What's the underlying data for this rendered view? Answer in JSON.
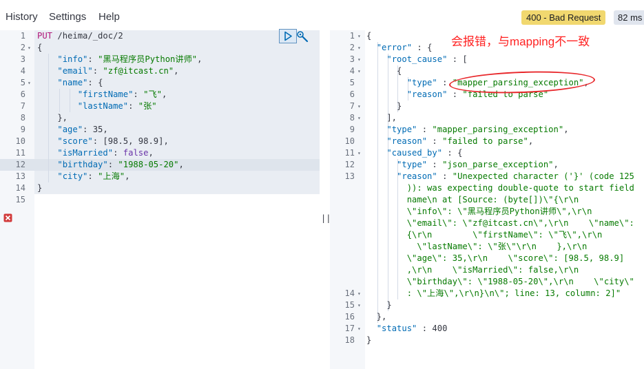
{
  "menu": {
    "history": "History",
    "settings": "Settings",
    "help": "Help"
  },
  "response_status": {
    "label": "400 - Bad Request",
    "time": "82 ms"
  },
  "annotation": "会报错，与mapping不一致",
  "divider_glyph": "||",
  "icons": {
    "run": "play-icon",
    "wrench": "wrench-icon",
    "error": "error-icon"
  },
  "request": {
    "line_numbers": [
      "1",
      "2",
      "3",
      "4",
      "5",
      "6",
      "7",
      "8",
      "9",
      "10",
      "11",
      "12",
      "13",
      "14",
      "15"
    ],
    "lines": [
      [
        {
          "t": "PUT",
          "c": "kw"
        },
        {
          "t": " /heima/_doc/2",
          "c": "n"
        }
      ],
      [
        {
          "t": "{",
          "c": "n"
        }
      ],
      [
        {
          "t": "    ",
          "c": "n"
        },
        {
          "t": "\"info\"",
          "c": "k"
        },
        {
          "t": ": ",
          "c": "n"
        },
        {
          "t": "\"黑马程序员Python讲师\"",
          "c": "s"
        },
        {
          "t": ",",
          "c": "n"
        }
      ],
      [
        {
          "t": "    ",
          "c": "n"
        },
        {
          "t": "\"email\"",
          "c": "k"
        },
        {
          "t": ": ",
          "c": "n"
        },
        {
          "t": "\"zf@itcast.cn\"",
          "c": "s"
        },
        {
          "t": ",",
          "c": "n"
        }
      ],
      [
        {
          "t": "    ",
          "c": "n"
        },
        {
          "t": "\"name\"",
          "c": "k"
        },
        {
          "t": ": {",
          "c": "n"
        }
      ],
      [
        {
          "t": "        ",
          "c": "n"
        },
        {
          "t": "\"firstName\"",
          "c": "k"
        },
        {
          "t": ": ",
          "c": "n"
        },
        {
          "t": "\"飞\"",
          "c": "s"
        },
        {
          "t": ",",
          "c": "n"
        }
      ],
      [
        {
          "t": "        ",
          "c": "n"
        },
        {
          "t": "\"lastName\"",
          "c": "k"
        },
        {
          "t": ": ",
          "c": "n"
        },
        {
          "t": "\"张\"",
          "c": "s"
        }
      ],
      [
        {
          "t": "    },",
          "c": "n"
        }
      ],
      [
        {
          "t": "    ",
          "c": "n"
        },
        {
          "t": "\"age\"",
          "c": "k"
        },
        {
          "t": ": 35,",
          "c": "n"
        }
      ],
      [
        {
          "t": "    ",
          "c": "n"
        },
        {
          "t": "\"score\"",
          "c": "k"
        },
        {
          "t": ": [98.5, 98.9],",
          "c": "n"
        }
      ],
      [
        {
          "t": "    ",
          "c": "n"
        },
        {
          "t": "\"isMarried\"",
          "c": "k"
        },
        {
          "t": ": ",
          "c": "n"
        },
        {
          "t": "false",
          "c": "bool"
        },
        {
          "t": ",",
          "c": "n"
        }
      ],
      [
        {
          "t": "    ",
          "c": "n"
        },
        {
          "t": "\"birthday\"",
          "c": "k"
        },
        {
          "t": ": ",
          "c": "n"
        },
        {
          "t": "\"1988-05-20\"",
          "c": "s"
        },
        {
          "t": ",",
          "c": "n"
        }
      ],
      [
        {
          "t": "    ",
          "c": "n"
        },
        {
          "t": "\"city\"",
          "c": "k"
        },
        {
          "t": ": ",
          "c": "n"
        },
        {
          "t": "\"上海\"",
          "c": "s"
        },
        {
          "t": ",",
          "c": "n"
        }
      ],
      [
        {
          "t": "}",
          "c": "n"
        }
      ],
      [
        {
          "t": "",
          "c": "n"
        }
      ]
    ]
  },
  "response": {
    "line_numbers": [
      "1",
      "2",
      "3",
      "4",
      "5",
      "6",
      "7",
      "8",
      "9",
      "10",
      "11",
      "12",
      "13",
      "",
      "",
      "",
      "",
      "",
      "",
      "",
      "",
      "",
      "14",
      "15",
      "16",
      "17",
      "18"
    ],
    "lines": [
      [
        {
          "t": "{",
          "c": "n"
        }
      ],
      [
        {
          "t": "  ",
          "c": "n"
        },
        {
          "t": "\"error\"",
          "c": "rk"
        },
        {
          "t": " : {",
          "c": "n"
        }
      ],
      [
        {
          "t": "    ",
          "c": "n"
        },
        {
          "t": "\"root_cause\"",
          "c": "rk"
        },
        {
          "t": " : [",
          "c": "n"
        }
      ],
      [
        {
          "t": "      {",
          "c": "n"
        }
      ],
      [
        {
          "t": "        ",
          "c": "n"
        },
        {
          "t": "\"type\"",
          "c": "rk"
        },
        {
          "t": " : ",
          "c": "n"
        },
        {
          "t": "\"mapper_parsing_exception\"",
          "c": "rs"
        },
        {
          "t": ",",
          "c": "n"
        }
      ],
      [
        {
          "t": "        ",
          "c": "n"
        },
        {
          "t": "\"reason\"",
          "c": "rk"
        },
        {
          "t": " : ",
          "c": "n"
        },
        {
          "t": "\"failed to parse\"",
          "c": "rs"
        }
      ],
      [
        {
          "t": "      }",
          "c": "n"
        }
      ],
      [
        {
          "t": "    ],",
          "c": "n"
        }
      ],
      [
        {
          "t": "    ",
          "c": "n"
        },
        {
          "t": "\"type\"",
          "c": "rk"
        },
        {
          "t": " : ",
          "c": "n"
        },
        {
          "t": "\"mapper_parsing_exception\"",
          "c": "rs"
        },
        {
          "t": ",",
          "c": "n"
        }
      ],
      [
        {
          "t": "    ",
          "c": "n"
        },
        {
          "t": "\"reason\"",
          "c": "rk"
        },
        {
          "t": " : ",
          "c": "n"
        },
        {
          "t": "\"failed to parse\"",
          "c": "rs"
        },
        {
          "t": ",",
          "c": "n"
        }
      ],
      [
        {
          "t": "    ",
          "c": "n"
        },
        {
          "t": "\"caused_by\"",
          "c": "rk"
        },
        {
          "t": " : {",
          "c": "n"
        }
      ],
      [
        {
          "t": "      ",
          "c": "n"
        },
        {
          "t": "\"type\"",
          "c": "rk"
        },
        {
          "t": " : ",
          "c": "n"
        },
        {
          "t": "\"json_parse_exception\"",
          "c": "rs"
        },
        {
          "t": ",",
          "c": "n"
        }
      ],
      [
        {
          "t": "      ",
          "c": "n"
        },
        {
          "t": "\"reason\"",
          "c": "rk"
        },
        {
          "t": " : ",
          "c": "n"
        },
        {
          "t": "\"Unexpected character ('}' (code 125",
          "c": "rs"
        }
      ],
      [
        {
          "t": "        )): was expecting double-quote to start field",
          "c": "rs"
        }
      ],
      [
        {
          "t": "        name\\n at [Source: (byte[])\\\"{\\r\\n",
          "c": "rs"
        }
      ],
      [
        {
          "t": "        \\\"info\\\": \\\"黑马程序员Python讲师\\\",\\r\\n",
          "c": "rs"
        }
      ],
      [
        {
          "t": "        \\\"email\\\": \\\"zf@itcast.cn\\\",\\r\\n    \\\"name\\\":",
          "c": "rs"
        }
      ],
      [
        {
          "t": "        {\\r\\n        \\\"firstName\\\": \\\"飞\\\",\\r\\n",
          "c": "rs"
        }
      ],
      [
        {
          "t": "          \\\"lastName\\\": \\\"张\\\"\\r\\n    },\\r\\n",
          "c": "rs"
        }
      ],
      [
        {
          "t": "        \\\"age\\\": 35,\\r\\n    \\\"score\\\": [98.5, 98.9]",
          "c": "rs"
        }
      ],
      [
        {
          "t": "        ,\\r\\n    \\\"isMarried\\\": false,\\r\\n",
          "c": "rs"
        }
      ],
      [
        {
          "t": "        \\\"birthday\\\": \\\"1988-05-20\\\",\\r\\n    \\\"city\\\"",
          "c": "rs"
        }
      ],
      [
        {
          "t": "        : \\\"上海\\\",\\r\\n}\\n\\\"; line: 13, column: 2]\"",
          "c": "rs"
        }
      ],
      [
        {
          "t": "    }",
          "c": "n"
        }
      ],
      [
        {
          "t": "  },",
          "c": "n"
        }
      ],
      [
        {
          "t": "  ",
          "c": "n"
        },
        {
          "t": "\"status\"",
          "c": "rk"
        },
        {
          "t": " : 400",
          "c": "n"
        }
      ],
      [
        {
          "t": "}",
          "c": "n"
        }
      ],
      [
        {
          "t": "",
          "c": "n"
        }
      ]
    ]
  }
}
